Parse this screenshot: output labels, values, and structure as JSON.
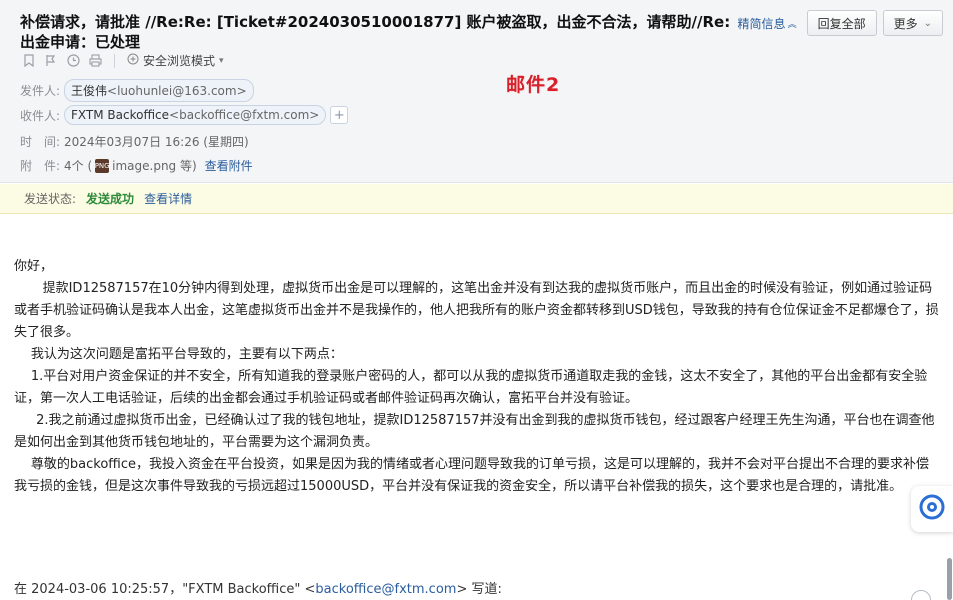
{
  "header": {
    "subject": "补偿请求，请批准 //Re:Re: [Ticket#2024030510001877] 账户被盗取，出金不合法，请帮助//Re:出金申请：已处理",
    "brief_info": "精简信息",
    "reply_all": "回复全部",
    "more": "更多",
    "safe_mode": "安全浏览模式",
    "stamp": "邮件2"
  },
  "meta": {
    "from_label": "发件人:",
    "from_name": "王俊伟",
    "from_addr": "<luohunlei@163.com>",
    "to_label": "收件人:",
    "to_name": "FXTM Backoffice",
    "to_addr": "<backoffice@fxtm.com>",
    "time_label": "时　间:",
    "time_value": "2024年03月07日 16:26 (星期四)",
    "attach_label": "附　件:",
    "attach_count": "4个 (",
    "attach_file": "image.png 等)",
    "view_attach": "查看附件",
    "attach_icon_text": "PNG"
  },
  "status": {
    "label": "发送状态:",
    "value": "发送成功",
    "details": "查看详情"
  },
  "body": {
    "greeting": "你好，",
    "p1": "提款ID12587157在10分钟内得到处理，虚拟货币出金是可以理解的，这笔出金并没有到达我的虚拟货币账户，而且出金的时候没有验证，例如通过验证码或者手机验证码确认是我本人出金，这笔虚拟货币出金并不是我操作的，他人把我所有的账户资金都转移到USD钱包，导致我的持有仓位保证金不足都爆仓了，损失了很多。",
    "p2": "我认为这次问题是富拓平台导致的，主要有以下两点：",
    "p3": "1.平台对用户资金保证的并不安全，所有知道我的登录账户密码的人，都可以从我的虚拟货币通道取走我的金钱，这太不安全了，其他的平台出金都有安全验证，第一次人工电话验证，后续的出金都会通过手机验证码或者邮件验证码再次确认，富拓平台并没有验证。",
    "p4": "2.我之前通过虚拟货币出金，已经确认过了我的钱包地址，提款ID12587157并没有出金到我的虚拟货币钱包，经过跟客户经理王先生沟通，平台也在调查他是如何出金到其他货币钱包地址的，平台需要为这个漏洞负责。",
    "p5": "尊敬的backoffice，我投入资金在平台投资，如果是因为我的情绪或者心理问题导致我的订单亏损，这是可以理解的，我并不会对平台提出不合理的要求补偿我亏损的金钱，但是这次事件导致我的亏损远超过15000USD，平台并没有保证我的资金安全，所以请平台补偿我的损失，这个要求也是合理的，请批准。"
  },
  "quote": {
    "prefix": "在 2024-03-06 10:25:57，\"FXTM Backoffice\" <",
    "email": "backoffice@fxtm.com",
    "suffix": "> 写道:"
  },
  "colors": {
    "link": "#2a5d9e",
    "success": "#2e8b3a",
    "stamp": "#d6202a"
  }
}
